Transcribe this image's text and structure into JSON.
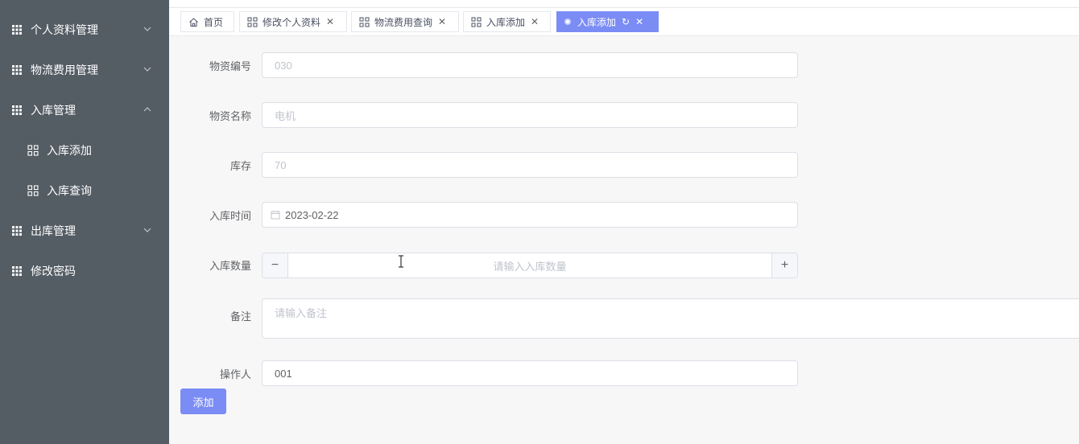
{
  "sidebar": {
    "items": [
      {
        "label": "个人资料管理",
        "chevron": "down"
      },
      {
        "label": "物流费用管理",
        "chevron": "down"
      },
      {
        "label": "入库管理",
        "chevron": "up"
      },
      {
        "label": "出库管理",
        "chevron": "down"
      },
      {
        "label": "修改密码"
      }
    ],
    "subitems": [
      {
        "label": "入库添加"
      },
      {
        "label": "入库查询"
      }
    ]
  },
  "tabs": [
    {
      "label": "首页",
      "icon": "home-icon"
    },
    {
      "label": "修改个人资料",
      "icon": "apps-icon",
      "close": "✕"
    },
    {
      "label": "物流费用查询",
      "icon": "apps-icon",
      "close": "✕"
    },
    {
      "label": "入库添加",
      "icon": "apps-icon",
      "close": "✕"
    },
    {
      "label": "入库添加",
      "icon": "dot",
      "active": true,
      "refresh": "↻",
      "close": "✕"
    }
  ],
  "form": {
    "material_no": {
      "label": "物资编号",
      "value": "030"
    },
    "material_name": {
      "label": "物资名称",
      "value": "电机"
    },
    "stock": {
      "label": "库存",
      "value": "70"
    },
    "in_time": {
      "label": "入库时间",
      "value": "2023-02-22"
    },
    "quantity": {
      "label": "入库数量",
      "placeholder": "请输入入库数量",
      "minus": "−",
      "plus": "+"
    },
    "remark": {
      "label": "备注",
      "placeholder": "请输入备注"
    },
    "operator": {
      "label": "操作人",
      "value": "001"
    },
    "submit_label": "添加"
  },
  "colors": {
    "sidebar_bg": "#545c64",
    "accent": "#7b8cf5",
    "page_bg": "#f7f7f7"
  }
}
